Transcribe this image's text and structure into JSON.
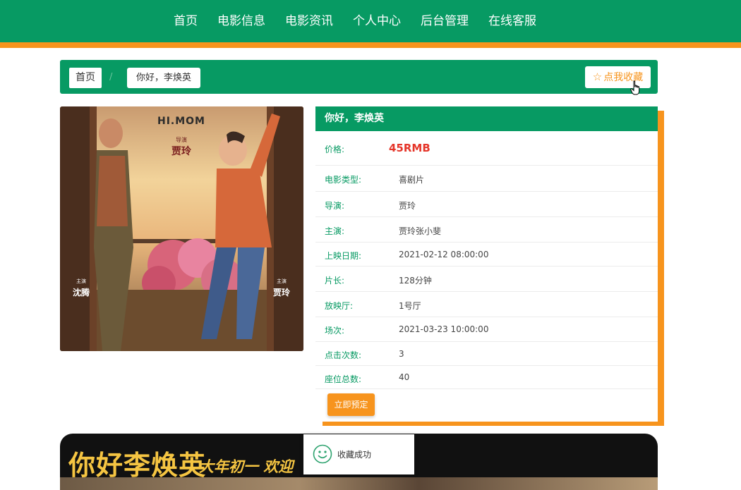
{
  "nav": {
    "items": [
      "首页",
      "电影信息",
      "电影资讯",
      "个人中心",
      "后台管理",
      "在线客服"
    ]
  },
  "breadcrumb": {
    "home": "首页",
    "separator": "/",
    "current": "你好，李焕英"
  },
  "favorite": {
    "icon": "star-outline-icon",
    "label": "点我收藏"
  },
  "poster": {
    "title_en": "HI.MOM",
    "director_caption": "导演",
    "director_name": "贾玲",
    "left_star_caption": "主演",
    "left_star_name": "沈腾",
    "right_star_caption": "主演",
    "right_star_name": "贾玲"
  },
  "detail": {
    "title": "你好，李焕英",
    "price_label": "价格:",
    "price_value": "45RMB",
    "rows": [
      {
        "label": "电影类型:",
        "value": "喜剧片"
      },
      {
        "label": "导演:",
        "value": "贾玲"
      },
      {
        "label": "主演:",
        "value": "贾玲张小斐"
      },
      {
        "label": "上映日期:",
        "value": "2021-02-12 08:00:00"
      },
      {
        "label": "片长:",
        "value": "128分钟"
      },
      {
        "label": "放映厅:",
        "value": "1号厅"
      },
      {
        "label": "场次:",
        "value": "2021-03-23 10:00:00"
      },
      {
        "label": "点击次数:",
        "value": "3"
      },
      {
        "label": "座位总数:",
        "value": "40"
      }
    ],
    "book_button": "立即预定"
  },
  "banner": {
    "title": "你好李焕英",
    "subtitle": "大年初一 欢迎"
  },
  "toast": {
    "icon": "smile-icon",
    "message": "收藏成功"
  },
  "colors": {
    "primary": "#079a63",
    "accent": "#f7941d",
    "price": "#e5362a"
  }
}
